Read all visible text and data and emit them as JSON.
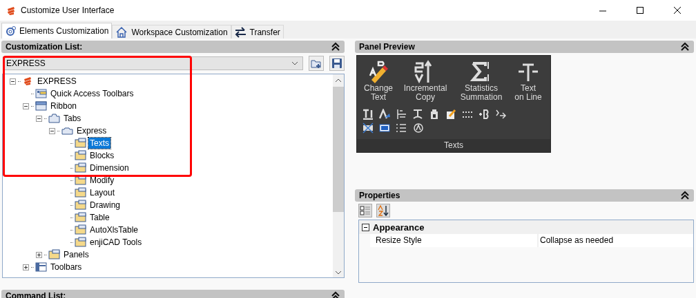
{
  "window": {
    "title": "Customize User Interface"
  },
  "tabs": [
    {
      "label": "Elements Customization",
      "kind": "gear",
      "selected": true
    },
    {
      "label": "Workspace Customization",
      "kind": "house",
      "selected": false
    },
    {
      "label": "Transfer",
      "kind": "arrows",
      "selected": false
    }
  ],
  "customization_list": {
    "title": "Customization List:",
    "dropdown": {
      "value": "EXPRESS"
    },
    "tree": [
      {
        "label": "EXPRESS",
        "kind": "root",
        "expanded": true,
        "selected": false,
        "children": [
          {
            "label": "Quick Access Toolbars",
            "kind": "qat",
            "selected": false
          },
          {
            "label": "Ribbon",
            "kind": "ribbon",
            "expanded": true,
            "selected": false,
            "children": [
              {
                "label": "Tabs",
                "kind": "tabs",
                "expanded": true,
                "selected": false,
                "children": [
                  {
                    "label": "Express",
                    "kind": "tab",
                    "expanded": true,
                    "selected": false,
                    "children": [
                      {
                        "label": "Texts",
                        "kind": "panel",
                        "selected": true
                      },
                      {
                        "label": "Blocks",
                        "kind": "panel",
                        "selected": false
                      },
                      {
                        "label": "Dimension",
                        "kind": "panel",
                        "selected": false
                      },
                      {
                        "label": "Modify",
                        "kind": "panel",
                        "selected": false
                      },
                      {
                        "label": "Layout",
                        "kind": "panel",
                        "selected": false
                      },
                      {
                        "label": "Drawing",
                        "kind": "panel",
                        "selected": false
                      },
                      {
                        "label": "Table",
                        "kind": "panel",
                        "selected": false
                      },
                      {
                        "label": "AutoXlsTable",
                        "kind": "panel",
                        "selected": false
                      },
                      {
                        "label": "enjiCAD Tools",
                        "kind": "panel",
                        "selected": false
                      }
                    ]
                  }
                ]
              },
              {
                "label": "Panels",
                "kind": "panel",
                "expanded": false,
                "selected": false
              }
            ]
          },
          {
            "label": "Toolbars",
            "kind": "toolbars",
            "expanded": false,
            "selected": false
          }
        ]
      }
    ]
  },
  "command_list": {
    "title": "Command List:"
  },
  "panel_preview": {
    "title": "Panel Preview",
    "large_buttons": [
      {
        "kind": "change-text",
        "lines": [
          "Change",
          "Text"
        ]
      },
      {
        "kind": "incremental",
        "lines": [
          "Incremental",
          "Copy"
        ]
      },
      {
        "kind": "sigma",
        "lines": [
          "Statistics",
          "Summation"
        ]
      },
      {
        "kind": "text-line",
        "lines": [
          "Text",
          "on Line"
        ]
      }
    ],
    "panel_label": "Texts"
  },
  "properties": {
    "title": "Properties",
    "categories": [
      {
        "name": "Appearance",
        "expanded": true,
        "rows": [
          {
            "name": "Resize Style",
            "value": "Collapse as needed"
          }
        ]
      }
    ]
  }
}
